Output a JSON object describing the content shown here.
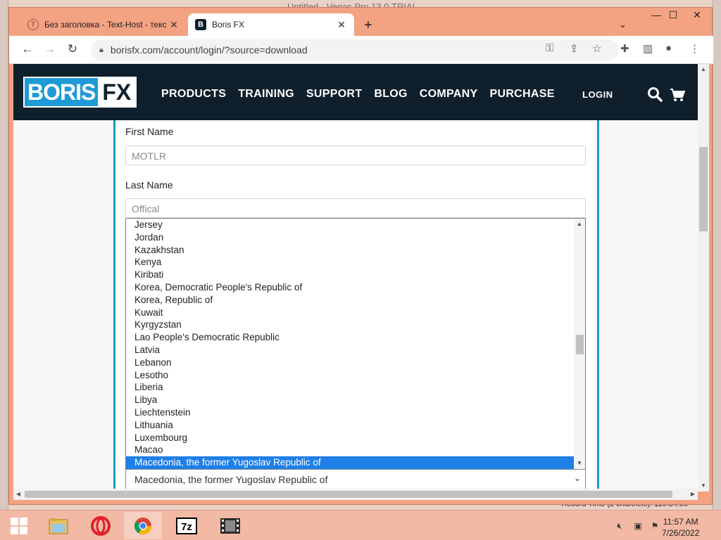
{
  "background_app": {
    "title": "Untitled - Vegas Pro 13.0 TRIAL",
    "status": "Record Time (2 channels): 119:34:05"
  },
  "browser": {
    "tabs": [
      {
        "title": "Без заголовка - Text-Host - текс",
        "active": false,
        "favicon": "text-host-icon"
      },
      {
        "title": "Boris FX",
        "active": true,
        "favicon": "borisfx-icon"
      }
    ],
    "new_tab_label": "+",
    "url": "borisfx.com/account/login/?source=download"
  },
  "site": {
    "logo": {
      "part1": "BORIS",
      "part2": "FX"
    },
    "nav": [
      "PRODUCTS",
      "TRAINING",
      "SUPPORT",
      "BLOG",
      "COMPANY",
      "PURCHASE"
    ],
    "login": "LOGIN"
  },
  "form": {
    "first_name_label": "First Name",
    "first_name_value": "MOTLR",
    "last_name_label": "Last Name",
    "last_name_value": "Offical",
    "country_options": [
      "Jersey",
      "Jordan",
      "Kazakhstan",
      "Kenya",
      "Kiribati",
      "Korea, Democratic People's Republic of",
      "Korea, Republic of",
      "Kuwait",
      "Kyrgyzstan",
      "Lao People's Democratic Republic",
      "Latvia",
      "Lebanon",
      "Lesotho",
      "Liberia",
      "Libya",
      "Liechtenstein",
      "Lithuania",
      "Luxembourg",
      "Macao",
      "Macedonia, the former Yugoslav Republic of"
    ],
    "country_selected": "Macedonia, the former Yugoslav Republic of"
  },
  "taskbar": {
    "apps": [
      "start-icon",
      "file-explorer-icon",
      "opera-icon",
      "chrome-icon",
      "7zip-icon",
      "vegas-icon"
    ],
    "time": "11:57 AM",
    "date": "7/26/2022"
  },
  "colors": {
    "browser_frame": "#f3a282",
    "site_nav": "#0f1f2b",
    "brand_blue": "#1f9ad6",
    "form_accent": "#1a9bbd",
    "selection": "#1e7fe6"
  }
}
